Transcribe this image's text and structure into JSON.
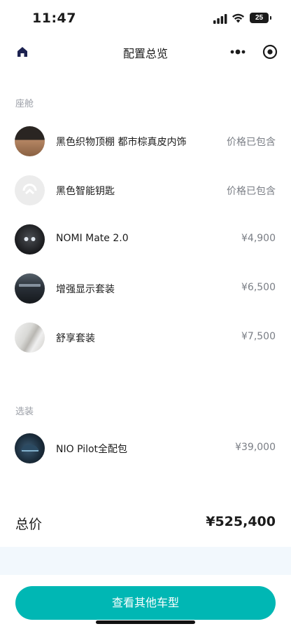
{
  "status_bar": {
    "time": "11:47",
    "battery": "25"
  },
  "nav": {
    "title": "配置总览"
  },
  "cabin": {
    "header": "座舱",
    "items": [
      {
        "name": "黑色织物顶棚 都市棕真皮内饰",
        "price": "价格已包含",
        "icon": "ceiling-interior-thumbnail"
      },
      {
        "name": "黑色智能钥匙",
        "price": "价格已包含",
        "icon": "nio-key-thumbnail"
      },
      {
        "name": "NOMI Mate 2.0",
        "price": "¥4,900",
        "icon": "nomi-thumbnail"
      },
      {
        "name": "增强显示套装",
        "price": "¥6,500",
        "icon": "display-package-thumbnail"
      },
      {
        "name": "舒享套装",
        "price": "¥7,500",
        "icon": "comfort-package-thumbnail"
      }
    ]
  },
  "options": {
    "header": "选装",
    "items": [
      {
        "name": "NIO Pilot全配包",
        "price": "¥39,000",
        "icon": "pilot-package-thumbnail"
      }
    ]
  },
  "total": {
    "label": "总价",
    "value": "¥525,400"
  },
  "cta": {
    "label": "查看其他车型"
  },
  "colors": {
    "accent": "#00b7b4",
    "muted_text": "#9a9ea6",
    "price_text": "#7a7e85"
  }
}
